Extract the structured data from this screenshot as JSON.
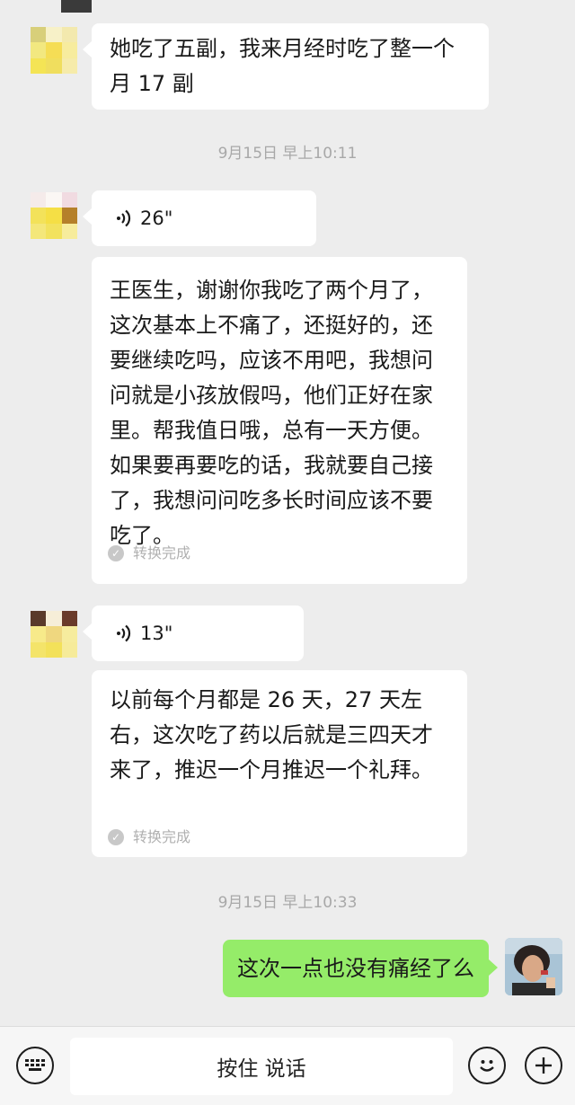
{
  "messages": {
    "m1": {
      "text": "她吃了五副，我来月经时吃了整一个月 17 副"
    },
    "ts1": "9月15日 早上10:11",
    "v1": {
      "duration": "26\""
    },
    "t1": {
      "text": "王医生，谢谢你我吃了两个月了，这次基本上不痛了，还挺好的，还要继续吃吗，应该不用吧，我想问问就是小孩放假吗，他们正好在家里。帮我值日哦，总有一天方便。如果要再要吃的话，我就要自己接了，我想问问吃多长时间应该不要吃了。",
      "status": "转换完成"
    },
    "v2": {
      "duration": "13\""
    },
    "t2": {
      "text": "以前每个月都是 26 天，27 天左右，这次吃了药以后就是三四天才来了，推迟一个月推迟一个礼拜。",
      "status": "转换完成"
    },
    "ts2": "9月15日 早上10:33",
    "r1": {
      "text": "这次一点也没有痛经了么"
    }
  },
  "input_bar": {
    "hold_to_talk": "按住 说话",
    "keyboard_icon": "keyboard-icon",
    "emoji_icon": "emoji-icon",
    "plus_icon": "plus-icon"
  },
  "colors": {
    "background": "#ededed",
    "sent_bubble": "#95ec69",
    "received_bubble": "#ffffff"
  }
}
